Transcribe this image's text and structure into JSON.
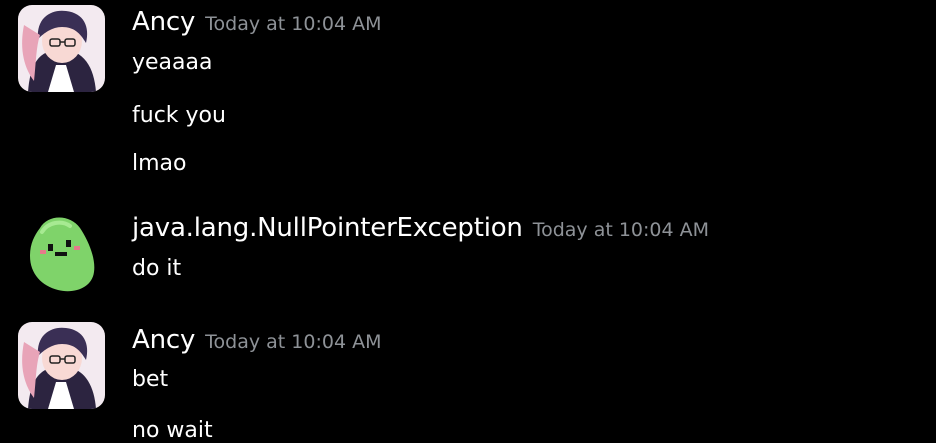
{
  "messages": [
    {
      "author": "Ancy",
      "timestamp": "Today at 10:04 AM",
      "avatar_icon": "anime-character-avatar",
      "lines": [
        "yeaaaa",
        "fuck you",
        "lmao"
      ]
    },
    {
      "author": "java.lang.NullPointerException",
      "timestamp": "Today at 10:04 AM",
      "avatar_icon": "green-bean-avatar",
      "lines": [
        "do it"
      ]
    },
    {
      "author": "Ancy",
      "timestamp": "Today at 10:04 AM",
      "avatar_icon": "anime-character-avatar",
      "lines": [
        "bet",
        "no wait"
      ]
    }
  ],
  "colors": {
    "background": "#000000",
    "text": "#ffffff",
    "timestamp": "#8e9297",
    "bean_green": "#7fd36a"
  }
}
